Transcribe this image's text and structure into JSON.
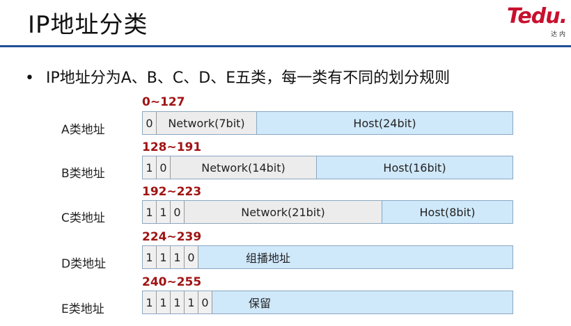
{
  "header": {
    "title": "IP地址分类",
    "logo_text": "Tedu.",
    "logo_sub": "达 内"
  },
  "bullet": {
    "text": "IP地址分为A、B、C、D、E五类，每一类有不同的划分规则"
  },
  "classes": [
    {
      "label": "A类地址",
      "range": "0~127",
      "bits": [
        "0"
      ],
      "network": "Network(7bit)",
      "host": "Host(24bit)"
    },
    {
      "label": "B类地址",
      "range": "128~191",
      "bits": [
        "1",
        "0"
      ],
      "network": "Network(14bit)",
      "host": "Host(16bit)"
    },
    {
      "label": "C类地址",
      "range": "192~223",
      "bits": [
        "1",
        "1",
        "0"
      ],
      "network": "Network(21bit)",
      "host": "Host(8bit)"
    },
    {
      "label": "D类地址",
      "range": "224~239",
      "bits": [
        "1",
        "1",
        "1",
        "0"
      ],
      "text": "组播地址"
    },
    {
      "label": "E类地址",
      "range": "240~255",
      "bits": [
        "1",
        "1",
        "1",
        "1",
        "0"
      ],
      "text": "保留"
    }
  ],
  "colors": {
    "header_rule": "#1f4e96",
    "range_text": "#a01414",
    "host_fill": "#cfe8fa",
    "network_fill": "#ececec",
    "logo": "#c8102e"
  }
}
